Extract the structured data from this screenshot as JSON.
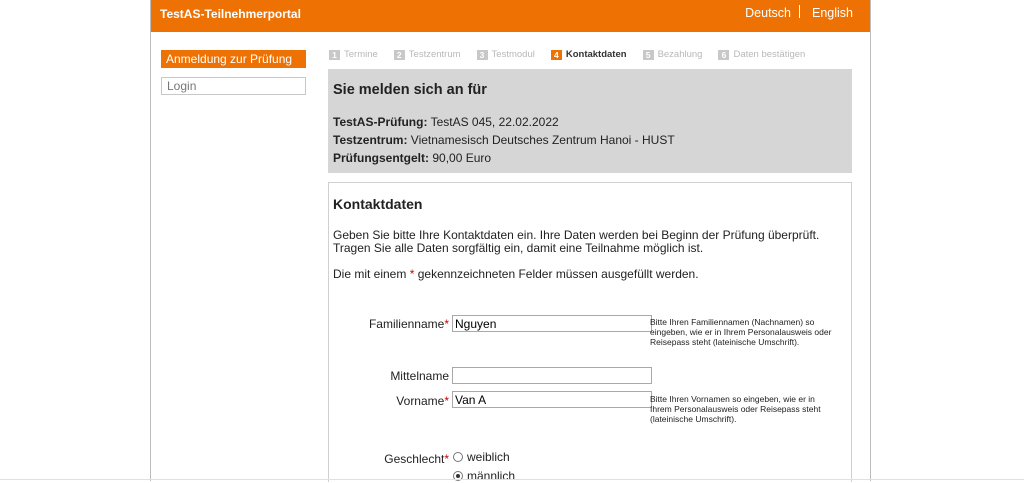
{
  "header": {
    "title": "TestAS-Teilnehmerportal",
    "lang_de": "Deutsch",
    "lang_en": "English"
  },
  "sidebar": {
    "items": [
      {
        "label": "Anmeldung zur Prüfung"
      },
      {
        "label": "Login"
      }
    ]
  },
  "steps": [
    {
      "num": "1",
      "label": "Termine"
    },
    {
      "num": "2",
      "label": "Testzentrum"
    },
    {
      "num": "3",
      "label": "Testmodul"
    },
    {
      "num": "4",
      "label": "Kontaktdaten"
    },
    {
      "num": "5",
      "label": "Bezahlung"
    },
    {
      "num": "6",
      "label": "Daten bestätigen"
    }
  ],
  "summary": {
    "title": "Sie melden sich an für",
    "exam_label": "TestAS-Prüfung:",
    "exam_value": "TestAS 045, 22.02.2022",
    "center_label": "Testzentrum:",
    "center_value": "Vietnamesisch Deutsches Zentrum Hanoi - HUST",
    "fee_label": "Prüfungsentgelt:",
    "fee_value": "90,00 Euro"
  },
  "form": {
    "title": "Kontaktdaten",
    "intro": "Geben Sie bitte Ihre Kontaktdaten ein. Ihre Daten werden bei Beginn der Prüfung überprüft. Tragen Sie alle Daten sorgfältig ein, damit eine Teilnahme möglich ist.",
    "required_prefix": "Die mit einem",
    "required_star": "*",
    "required_suffix": "gekennzeichneten Felder müssen ausgefüllt werden.",
    "lastname": {
      "label": "Familienname",
      "value": "Nguyen",
      "hint": "Bitte Ihren Familiennamen (Nachnamen) so eingeben, wie er in Ihrem Personalausweis oder Reisepass steht (lateinische Umschrift)."
    },
    "middlename": {
      "label": "Mittelname",
      "value": ""
    },
    "firstname": {
      "label": "Vorname",
      "value": "Van A",
      "hint": "Bitte Ihren Vornamen so eingeben, wie er in Ihrem Personalausweis oder Reisepass steht (lateinische Umschrift)."
    },
    "gender": {
      "label": "Geschlecht",
      "options": [
        "weiblich",
        "männlich"
      ],
      "selected": "männlich"
    }
  }
}
